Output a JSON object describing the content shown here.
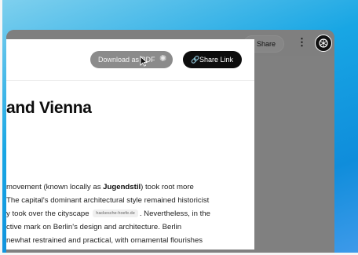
{
  "app_bar": {
    "share_label": "Share",
    "more_icon": "more-vertical-icon",
    "avatar_icon": "openai-logo-icon"
  },
  "doc": {
    "download_label": "Download as PDF",
    "download_state": "loading",
    "share_link_label": "Share Link",
    "title": "and Vienna",
    "body": {
      "line1_a": " movement (known locally as ",
      "line1_b": "Jugendstil",
      "line1_c": ") took root more",
      "line2": "The capital's dominant architectural style remained historicist",
      "line3_a": "y took over the cityscape",
      "line3_cite": "hackesche-hoefe.de",
      "line3_b": ". Nevertheless, in the",
      "line4": "ctive mark on Berlin's design and architecture. Berlin",
      "line5": "newhat restrained and practical, with ornamental flourishes"
    }
  },
  "colors": {
    "desktop_bg": "#18a6e4",
    "overlay": "#808080",
    "primary_button": "#0d0d0d",
    "disabled_button": "#8b8b8b"
  }
}
